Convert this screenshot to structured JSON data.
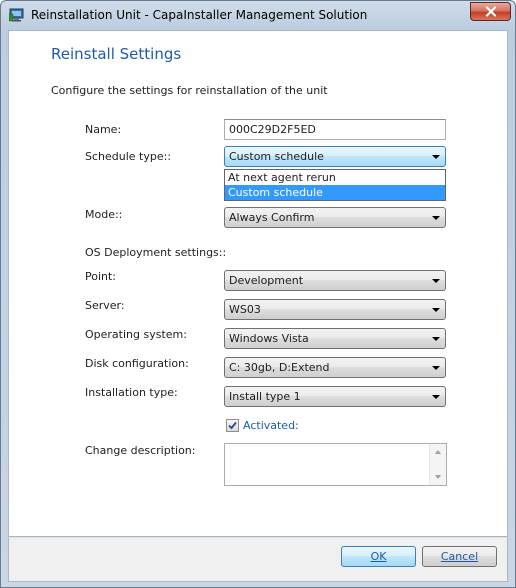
{
  "window": {
    "title": "Reinstallation Unit - CapaInstaller Management Solution",
    "close_icon": "close-x-icon",
    "app_icon": "computer-icon"
  },
  "header": {
    "heading": "Reinstall Settings",
    "subtitle": "Configure the settings for reinstallation of the unit"
  },
  "form": {
    "name_label": "Name:",
    "name_value": "000C29D2F5ED",
    "schedule_type_label": "Schedule type::",
    "schedule_type_value": "Custom schedule",
    "schedule_type_options": [
      "At next agent rerun",
      "Custom schedule"
    ],
    "schedule_type_selected_index": 1,
    "mode_label": "Mode::",
    "mode_value": "Always Confirm",
    "os_section_label": "OS Deployment settings::",
    "point_label": "Point:",
    "point_value": "Development",
    "server_label": "Server:",
    "server_value": "WS03",
    "os_label": "Operating system:",
    "os_value": "Windows Vista",
    "disk_label": "Disk configuration:",
    "disk_value": "C: 30gb, D:Extend",
    "install_type_label": "Installation type:",
    "install_type_value": "Install type 1",
    "activated_label": "Activated:",
    "activated_checked": true,
    "change_desc_label": "Change description:",
    "change_desc_value": ""
  },
  "footer": {
    "ok_label": "OK",
    "cancel_label": "Cancel"
  },
  "colors": {
    "accent": "#1e5aa8",
    "selection": "#3399ff"
  }
}
